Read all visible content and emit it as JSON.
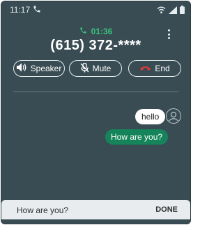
{
  "status_bar": {
    "time": "11:17",
    "icons": [
      "phone-icon",
      "wifi-calling-icon",
      "signal-icon",
      "battery-icon"
    ]
  },
  "call": {
    "timer": "01:36",
    "number": "(615) 372-****",
    "colors": {
      "timer": "#3bc47b",
      "end_icon": "#e53935"
    }
  },
  "controls": {
    "speaker_label": "Speaker",
    "mute_label": "Mute",
    "end_label": "End"
  },
  "chat": {
    "incoming": "hello",
    "outgoing": "How are you?"
  },
  "composer": {
    "text": "How are you?",
    "done_label": "DONE"
  },
  "colors": {
    "background": "#394c54",
    "outgoing_bubble": "#15845a",
    "incoming_bubble": "#ffffff"
  }
}
